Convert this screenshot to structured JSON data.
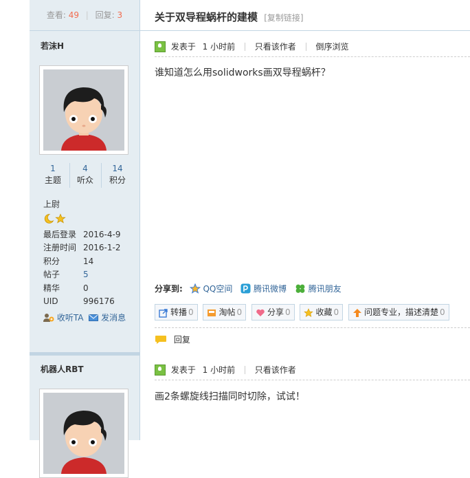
{
  "thread": {
    "views_label": "查看:",
    "views": "49",
    "replies_label": "回复:",
    "replies": "3",
    "title": "关于双导程蜗杆的建模",
    "copy_link": "[复制链接]"
  },
  "posts": [
    {
      "author": "若沫H",
      "stats": [
        {
          "value": "1",
          "label": "主题"
        },
        {
          "value": "4",
          "label": "听众"
        },
        {
          "value": "14",
          "label": "积分"
        }
      ],
      "rank": "上尉",
      "info": [
        {
          "key": "最后登录",
          "value": "2016-4-9"
        },
        {
          "key": "注册时间",
          "value": "2016-1-2"
        },
        {
          "key": "积分",
          "value": "14"
        },
        {
          "key": "帖子",
          "value": "5"
        },
        {
          "key": "精华",
          "value": "0"
        },
        {
          "key": "UID",
          "value": "996176"
        }
      ],
      "follow": "收听TA",
      "message": "发消息",
      "posted": "发表于",
      "time": "1 小时前",
      "only_author": "只看该作者",
      "reverse": "倒序浏览",
      "content": "谁知道怎么用solidworks画双导程蜗杆？",
      "share_label": "分享到:",
      "share": [
        "QQ空间",
        "腾讯微博",
        "腾讯朋友"
      ],
      "buttons": [
        {
          "label": "转播",
          "count": "0"
        },
        {
          "label": "淘帖",
          "count": "0"
        },
        {
          "label": "分享",
          "count": "0"
        },
        {
          "label": "收藏",
          "count": "0"
        },
        {
          "label": "问题专业，描述清楚",
          "count": "0"
        }
      ],
      "reply": "回复"
    },
    {
      "author": "机器人RBT",
      "posted": "发表于",
      "time": "1 小时前",
      "only_author": "只看该作者",
      "content": "画2条螺旋线扫描同时切除，试试！"
    }
  ],
  "colors": {
    "sidebar_bg": "#e5edf2",
    "border": "#c2d5e3",
    "link": "#336699",
    "highlight": "#f26c4f"
  }
}
